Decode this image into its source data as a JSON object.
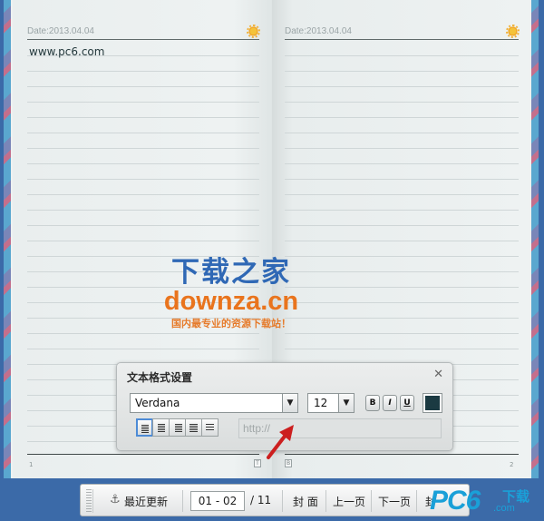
{
  "left_page": {
    "date": "Date:2013.04.04",
    "content": "www.pc6.com",
    "page_number": "1"
  },
  "right_page": {
    "date": "Date:2013.04.04",
    "page_number": "2"
  },
  "watermark": {
    "line1": "下载之家",
    "line2": "downza.cn",
    "line3": "国内最专业的资源下载站！"
  },
  "dialog": {
    "title": "文本格式设置",
    "close": "✕",
    "font": "Verdana",
    "size": "12",
    "bold": "B",
    "italic": "I",
    "underline": "U",
    "color": "#1b3a42",
    "url_placeholder": "http://"
  },
  "toolbar": {
    "recent": "最近更新",
    "page_range": "01 - 02",
    "total": "/ 11",
    "cover": "封 面",
    "prev": "上一页",
    "next": "下一页",
    "back_cover": "封"
  },
  "logo": {
    "pc": "PC6",
    "xiazai": "下载",
    "com": ".com"
  }
}
